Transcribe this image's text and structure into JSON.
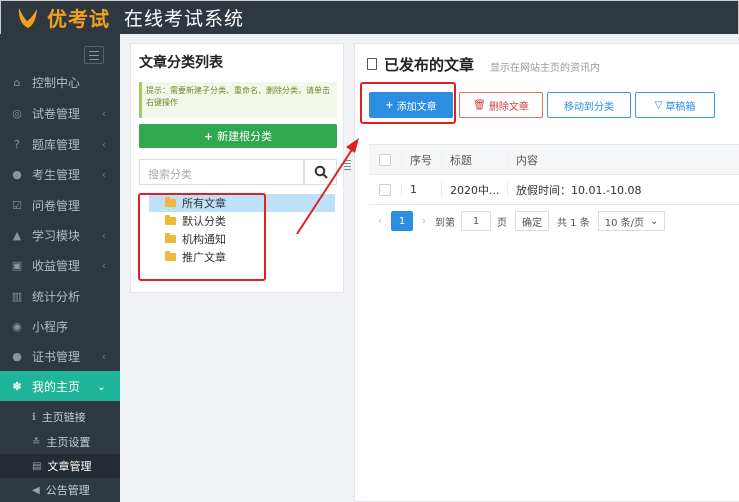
{
  "app": {
    "logo_text": "优考试",
    "title": "在线考试系统",
    "brand_color": "#f0a020",
    "accent": "#1fb59a"
  },
  "sidebar": {
    "items": [
      {
        "label": "控制中心",
        "icon": "home-icon"
      },
      {
        "label": "试卷管理",
        "icon": "check-circle-icon"
      },
      {
        "label": "题库管理",
        "icon": "question-icon"
      },
      {
        "label": "考生管理",
        "icon": "user-icon"
      },
      {
        "label": "问卷管理",
        "icon": "checkbox-icon"
      },
      {
        "label": "学习模块",
        "icon": "graduation-icon"
      },
      {
        "label": "收益管理",
        "icon": "money-icon"
      },
      {
        "label": "统计分析",
        "icon": "bar-chart-icon"
      },
      {
        "label": "小程序",
        "icon": "wechat-icon"
      },
      {
        "label": "证书管理",
        "icon": "certificate-icon"
      },
      {
        "label": "我的主页",
        "icon": "homepage-icon"
      }
    ],
    "sub_items": [
      {
        "label": "主页链接",
        "icon": "info-icon"
      },
      {
        "label": "主页设置",
        "icon": "settings-icon"
      },
      {
        "label": "文章管理",
        "icon": "file-icon"
      },
      {
        "label": "公告管理",
        "icon": "megaphone-icon"
      }
    ]
  },
  "category_panel": {
    "title": "文章分类列表",
    "hint": "提示：需要新建子分类、重命名、删除分类，请单击右键操作",
    "new_root_label": "新建根分类",
    "search_placeholder": "搜索分类",
    "tree": [
      "所有文章",
      "默认分类",
      "机构通知",
      "推广文章"
    ]
  },
  "article_panel": {
    "title": "已发布的文章",
    "subtitle": "显示在网站主页的资讯内",
    "buttons": {
      "add": "添加文章",
      "delete": "删除文章",
      "move": "移动到分类",
      "draft": "草稿箱"
    },
    "columns": [
      "序号",
      "标题",
      "内容"
    ],
    "rows": [
      {
        "no": "1",
        "title": "2020中...",
        "content": "放假时间：10.01.-10.08"
      }
    ],
    "pager": {
      "current": "1",
      "goto_label": "到第",
      "page_input": "1",
      "page_unit": "页",
      "confirm": "确定",
      "total": "共 1 条",
      "page_size": "10 条/页"
    }
  }
}
